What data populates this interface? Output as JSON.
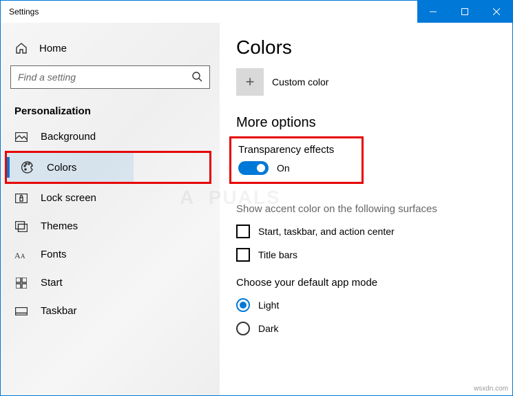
{
  "window": {
    "title": "Settings"
  },
  "sidebar": {
    "home": "Home",
    "search_placeholder": "Find a setting",
    "category": "Personalization",
    "items": [
      {
        "label": "Background"
      },
      {
        "label": "Colors"
      },
      {
        "label": "Lock screen"
      },
      {
        "label": "Themes"
      },
      {
        "label": "Fonts"
      },
      {
        "label": "Start"
      },
      {
        "label": "Taskbar"
      }
    ]
  },
  "main": {
    "title": "Colors",
    "custom_color_label": "Custom color",
    "more_options_title": "More options",
    "transparency_label": "Transparency effects",
    "transparency_state": "On",
    "accent_surfaces_label": "Show accent color on the following surfaces",
    "checkbox_start": "Start, taskbar, and action center",
    "checkbox_titlebars": "Title bars",
    "app_mode_label": "Choose your default app mode",
    "radio_light": "Light",
    "radio_dark": "Dark"
  },
  "attribution": "wsxdn.com"
}
